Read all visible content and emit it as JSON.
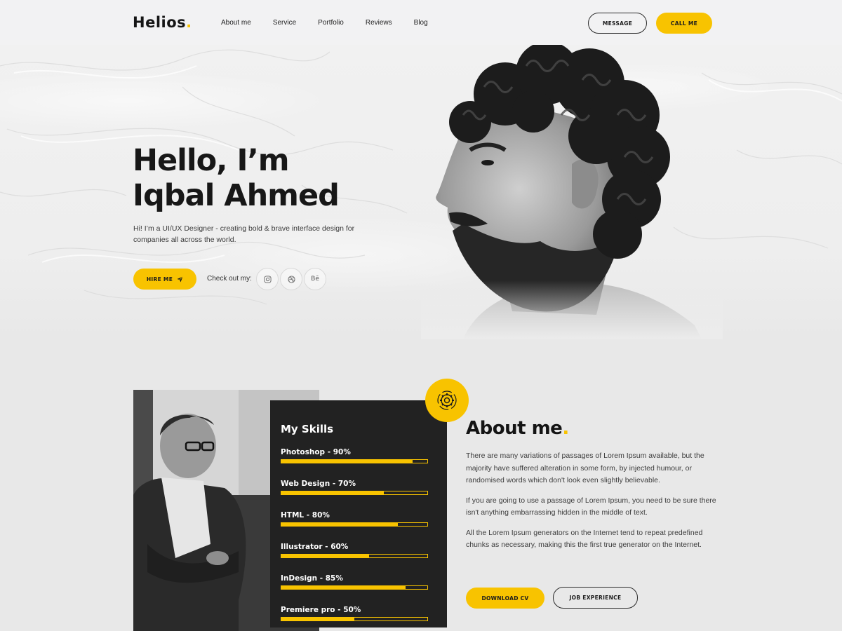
{
  "nav": {
    "logo": "Helios",
    "logo_dot": ".",
    "links": [
      "About me",
      "Service",
      "Portfolio",
      "Reviews",
      "Blog"
    ],
    "message_label": "MESSAGE",
    "call_label": "CALL ME"
  },
  "hero": {
    "title_line1": "Hello, I’m",
    "title_line2": "Iqbal Ahmed",
    "description": "Hi! I’m a UI/UX Designer - creating bold & brave interface design for companies all across the world.",
    "hire_label": "HIRE ME",
    "check_label": "Check out my:",
    "socials": [
      {
        "icon": "instagram-icon"
      },
      {
        "icon": "dribbble-icon"
      },
      {
        "icon": "behance-icon",
        "text": "Bē"
      }
    ]
  },
  "skills": {
    "title": "My Skills",
    "items": [
      {
        "label": "Photoshop - 90%",
        "value": 90
      },
      {
        "label": "Web Design - 70%",
        "value": 70
      },
      {
        "label": "HTML - 80%",
        "value": 80
      },
      {
        "label": "Illustrator - 60%",
        "value": 60
      },
      {
        "label": "InDesign - 85%",
        "value": 85
      },
      {
        "label": "Premiere pro - 50%",
        "value": 50
      }
    ]
  },
  "about": {
    "title": "About me",
    "title_dot": ".",
    "paragraphs": [
      "There are many variations of passages of Lorem Ipsum available, but the majority have suffered alteration in some form, by injected humour, or randomised words which don't look even slightly believable.",
      "If you are going to use a passage of Lorem Ipsum, you need to be sure there isn't anything embarrassing hidden in the middle of text.",
      "All the Lorem Ipsum generators on the Internet tend to repeat predefined chunks as necessary, making this the first true generator on the Internet."
    ],
    "download_label": "DOWNLOAD CV",
    "job_label": "JOB EXPERIENCE"
  },
  "colors": {
    "accent": "#f8c300",
    "dark": "#222222"
  }
}
